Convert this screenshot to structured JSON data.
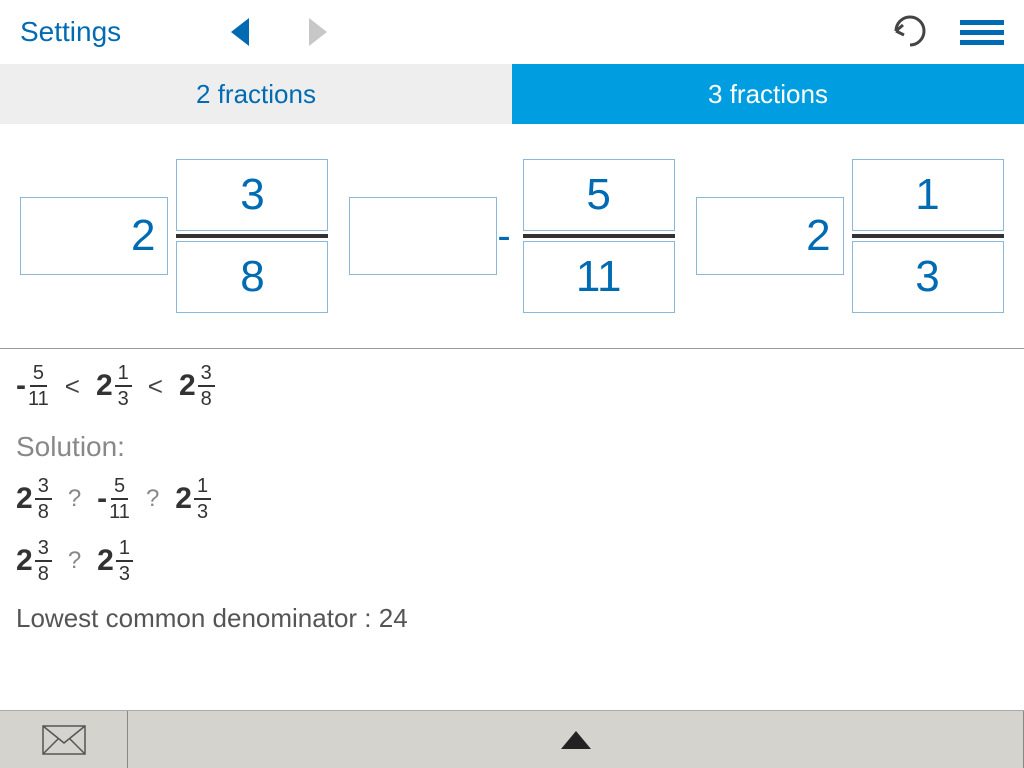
{
  "topbar": {
    "settings": "Settings"
  },
  "tabs": {
    "two": "2 fractions",
    "three": "3 fractions"
  },
  "inputs": [
    {
      "whole": "2",
      "neg": "",
      "num": "3",
      "den": "8"
    },
    {
      "whole": "",
      "neg": "-",
      "num": "5",
      "den": "11"
    },
    {
      "whole": "2",
      "neg": "",
      "num": "1",
      "den": "3"
    }
  ],
  "answer": {
    "ordered": [
      {
        "neg": "-",
        "whole": "",
        "num": "5",
        "den": "11"
      },
      {
        "neg": "",
        "whole": "2",
        "num": "1",
        "den": "3"
      },
      {
        "neg": "",
        "whole": "2",
        "num": "3",
        "den": "8"
      }
    ],
    "cmp": "<"
  },
  "solution": {
    "label": "Solution:",
    "line1": [
      {
        "neg": "",
        "whole": "2",
        "num": "3",
        "den": "8"
      },
      {
        "neg": "-",
        "whole": "",
        "num": "5",
        "den": "11"
      },
      {
        "neg": "",
        "whole": "2",
        "num": "1",
        "den": "3"
      }
    ],
    "line2": [
      {
        "neg": "",
        "whole": "2",
        "num": "3",
        "den": "8"
      },
      {
        "neg": "",
        "whole": "2",
        "num": "1",
        "den": "3"
      }
    ],
    "unknown": "?",
    "lcdLabel": "Lowest common denominator :",
    "lcdValue": "24"
  }
}
